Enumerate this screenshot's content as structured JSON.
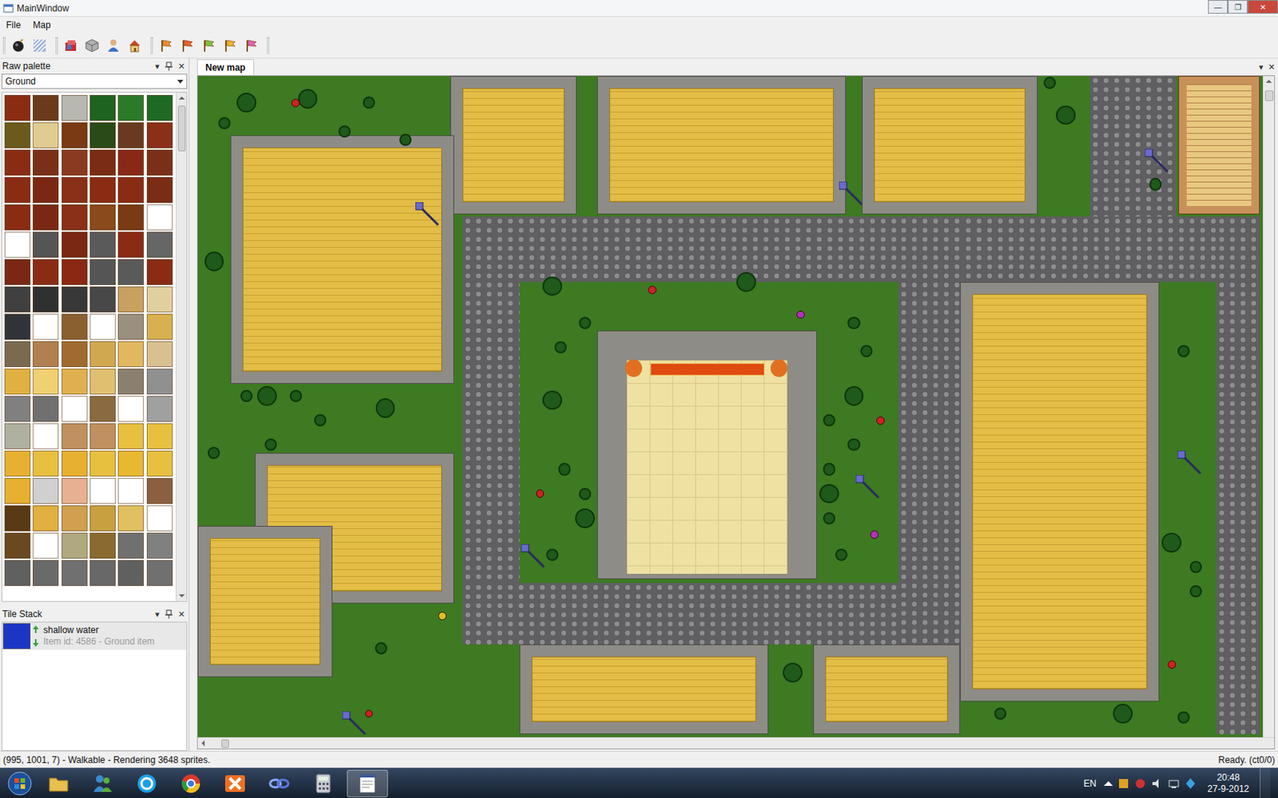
{
  "window": {
    "title": "MainWindow",
    "controls": [
      "—",
      "❐",
      "✕"
    ]
  },
  "menu": [
    {
      "label": "File"
    },
    {
      "label": "Map"
    }
  ],
  "toolbar": {
    "flags": [
      {
        "color": "#e8902a"
      },
      {
        "color": "#e8602a"
      },
      {
        "color": "#7cc23a"
      },
      {
        "color": "#f0b030"
      },
      {
        "color": "#e060b0"
      }
    ]
  },
  "palette": {
    "title": "Raw palette",
    "controls": [
      "▾",
      "✕"
    ],
    "category": "Ground",
    "tiles": [
      {
        "color": "#8a2c14"
      },
      {
        "color": "#6b3a1c"
      },
      {
        "color": "#b8b8b0"
      },
      {
        "color": "#1e6420"
      },
      {
        "color": "#2a7a2a"
      },
      {
        "color": "#1e6a24"
      },
      {
        "color": "#6b5a1c"
      },
      {
        "color": "#e0cc90"
      },
      {
        "color": "#7a3a14"
      },
      {
        "color": "#2a4a18"
      },
      {
        "color": "#6a3a20"
      },
      {
        "color": "#8a3018"
      },
      {
        "color": "#8a2c14"
      },
      {
        "color": "#7a3018"
      },
      {
        "color": "#8a3a20"
      },
      {
        "color": "#7a2c14"
      },
      {
        "color": "#8a2818"
      },
      {
        "color": "#7a3018"
      },
      {
        "color": "#8a2c14"
      },
      {
        "color": "#7a2814"
      },
      {
        "color": "#8a3018"
      },
      {
        "color": "#8a2c14"
      },
      {
        "color": "#8a2c14"
      },
      {
        "color": "#7a2c14"
      },
      {
        "color": "#8a2c14"
      },
      {
        "color": "#7a2814"
      },
      {
        "color": "#8a3018"
      },
      {
        "color": "#8a4a1c"
      },
      {
        "color": "#7a3a14"
      },
      {
        "color": "#ffffff"
      },
      {
        "color": "#ffffff"
      },
      {
        "color": "#555555"
      },
      {
        "color": "#7a2814"
      },
      {
        "color": "#5a5a5a"
      },
      {
        "color": "#8a2c14"
      },
      {
        "color": "#666666"
      },
      {
        "color": "#7a2814"
      },
      {
        "color": "#8a2c14"
      },
      {
        "color": "#8a2814"
      },
      {
        "color": "#555555"
      },
      {
        "color": "#5a5a5a"
      },
      {
        "color": "#8a2c14"
      },
      {
        "color": "#404040"
      },
      {
        "color": "#303030"
      },
      {
        "color": "#383838"
      },
      {
        "color": "#484848"
      },
      {
        "color": "#c8a060"
      },
      {
        "color": "#e0d0a0"
      },
      {
        "color": "#303438"
      },
      {
        "color": "#ffffff"
      },
      {
        "color": "#8a6030"
      },
      {
        "color": "#ffffff"
      },
      {
        "color": "#9a9080"
      },
      {
        "color": "#d8b050"
      },
      {
        "color": "#7a6a50"
      },
      {
        "color": "#b08050"
      },
      {
        "color": "#a06a30"
      },
      {
        "color": "#d0a850"
      },
      {
        "color": "#e0b860"
      },
      {
        "color": "#d8c090"
      },
      {
        "color": "#e0b040"
      },
      {
        "color": "#f0d070"
      },
      {
        "color": "#e0b050"
      },
      {
        "color": "#e0c070"
      },
      {
        "color": "#8a8070"
      },
      {
        "color": "#909090"
      },
      {
        "color": "#808080"
      },
      {
        "color": "#707070"
      },
      {
        "color": "#ffffff"
      },
      {
        "color": "#8a6a40"
      },
      {
        "color": "#ffffff"
      },
      {
        "color": "#a0a0a0"
      },
      {
        "color": "#b0b0a0"
      },
      {
        "color": "#ffffff"
      },
      {
        "color": "#c09060"
      },
      {
        "color": "#c09060"
      },
      {
        "color": "#e8c040"
      },
      {
        "color": "#e8c040"
      },
      {
        "color": "#e8b030"
      },
      {
        "color": "#e8c040"
      },
      {
        "color": "#e8b030"
      },
      {
        "color": "#e8c040"
      },
      {
        "color": "#e8b830"
      },
      {
        "color": "#e8c040"
      },
      {
        "color": "#e8b030"
      },
      {
        "color": "#d0d0d0"
      },
      {
        "color": "#e8b090"
      },
      {
        "color": "#ffffff"
      },
      {
        "color": "#ffffff"
      },
      {
        "color": "#8a6040"
      },
      {
        "color": "#5a3a14"
      },
      {
        "color": "#e0b040"
      },
      {
        "color": "#d0a050"
      },
      {
        "color": "#c8a040"
      },
      {
        "color": "#e0c060"
      },
      {
        "color": "#ffffff"
      },
      {
        "color": "#6a4820"
      },
      {
        "color": "#ffffff"
      },
      {
        "color": "#b0a880"
      },
      {
        "color": "#8a6a30"
      },
      {
        "color": "#707070"
      },
      {
        "color": "#808080"
      },
      {
        "color": "#606060"
      },
      {
        "color": "#6a6a6a"
      },
      {
        "color": "#707070"
      },
      {
        "color": "#686868"
      },
      {
        "color": "#606060"
      },
      {
        "color": "#707070"
      }
    ]
  },
  "tile_stack": {
    "title": "Tile Stack",
    "controls": [
      "▾",
      "✕"
    ],
    "items": [
      {
        "name": "shallow water",
        "detail": "Item id: 4586 - Ground item",
        "color": "#1b36c4",
        "selected": true
      }
    ]
  },
  "document": {
    "tabs": [
      {
        "label": "New map",
        "selected": true
      }
    ],
    "controls": [
      "▾",
      "✕"
    ]
  },
  "status_bar": {
    "left": "(995, 1001, 7) - Walkable - Rendering 3648 sprites.",
    "right": "Ready. (ct0/0)"
  },
  "taskbar": {
    "apps": [
      {
        "kind": "folder",
        "active": false
      },
      {
        "kind": "people",
        "active": false
      },
      {
        "kind": "skype",
        "active": false
      },
      {
        "kind": "chrome",
        "active": false
      },
      {
        "kind": "xapp",
        "active": false
      },
      {
        "kind": "infinity",
        "active": false
      },
      {
        "kind": "calculator",
        "active": false
      },
      {
        "kind": "editor",
        "active": true
      }
    ],
    "language": "EN",
    "time": "20:48",
    "date": "27-9-2012"
  }
}
